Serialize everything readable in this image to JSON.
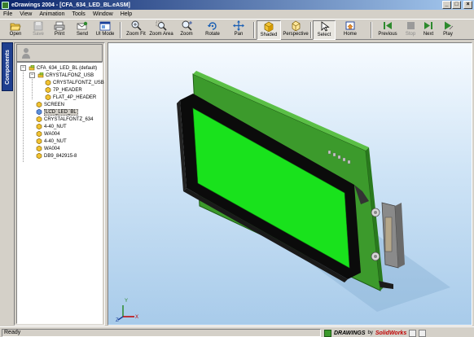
{
  "window": {
    "title": "eDrawings 2004 - [CFA_634_LED_BL.eASM]",
    "controls": {
      "minimize": "_",
      "maximize": "□",
      "close": "×"
    }
  },
  "menu": [
    "File",
    "View",
    "Animation",
    "Tools",
    "Window",
    "Help"
  ],
  "toolbar": {
    "buttons": [
      {
        "label": "Open",
        "icon": "open-folder-icon",
        "enabled": true
      },
      {
        "label": "Save",
        "icon": "save-disk-icon",
        "enabled": false
      },
      {
        "label": "Print",
        "icon": "printer-icon",
        "enabled": true
      },
      {
        "label": "Send",
        "icon": "send-mail-icon",
        "enabled": true
      },
      {
        "label": "UI Mode",
        "icon": "ui-mode-icon",
        "enabled": true
      },
      {
        "label": "Zoom Fit",
        "icon": "zoom-fit-icon",
        "enabled": true
      },
      {
        "label": "Zoom Area",
        "icon": "zoom-area-icon",
        "enabled": true
      },
      {
        "label": "Zoom",
        "icon": "zoom-icon",
        "enabled": true
      },
      {
        "label": "Rotate",
        "icon": "rotate-icon",
        "enabled": true
      },
      {
        "label": "Pan",
        "icon": "pan-icon",
        "enabled": true
      },
      {
        "label": "Shaded",
        "icon": "shaded-cube-icon",
        "enabled": true,
        "pressed": true
      },
      {
        "label": "Perspective",
        "icon": "perspective-cube-icon",
        "enabled": true
      },
      {
        "label": "Select",
        "icon": "select-arrow-icon",
        "enabled": true,
        "pressed": true
      },
      {
        "label": "Home",
        "icon": "home-icon",
        "enabled": true
      },
      {
        "label": "Previous",
        "icon": "previous-icon",
        "enabled": true
      },
      {
        "label": "Stop",
        "icon": "stop-icon",
        "enabled": false
      },
      {
        "label": "Next",
        "icon": "next-icon",
        "enabled": true
      },
      {
        "label": "Play",
        "icon": "play-icon",
        "enabled": true
      }
    ]
  },
  "side_tab": "Components",
  "tree": {
    "root": "CFA_634_LED_BL (default)",
    "items": [
      {
        "label": "CRYSTALFONZ_USB",
        "level": 1,
        "type": "assembly",
        "expanded": true
      },
      {
        "label": "CRYSTALFONTZ_USB",
        "level": 2,
        "type": "part"
      },
      {
        "label": "7P_HEADER",
        "level": 2,
        "type": "part"
      },
      {
        "label": "FLAT_4P_HEADER",
        "level": 2,
        "type": "part"
      },
      {
        "label": "SCREEN",
        "level": 1,
        "type": "part"
      },
      {
        "label": "LCD_LED_BL",
        "level": 1,
        "type": "part-blue",
        "selected": true
      },
      {
        "label": "CRYSTALFONTZ_634",
        "level": 1,
        "type": "part"
      },
      {
        "label": "4-40_NUT",
        "level": 1,
        "type": "part"
      },
      {
        "label": "WA004",
        "level": 1,
        "type": "part"
      },
      {
        "label": "4-40_NUT",
        "level": 1,
        "type": "part"
      },
      {
        "label": "WA004",
        "level": 1,
        "type": "part"
      },
      {
        "label": "DB9_842915-8",
        "level": 1,
        "type": "part"
      }
    ]
  },
  "triad": {
    "x": "X",
    "y": "Y",
    "z": "Z"
  },
  "status": {
    "text": "Ready",
    "brand_drawings": "DRAWINGS",
    "brand_by": "by",
    "brand_solidworks": "SolidWorks"
  },
  "colors": {
    "pcb_green": "#3c9a2c",
    "lcd_green": "#19e21c",
    "bezel_black": "#0b0b0b",
    "title_blue": "#0a246a"
  }
}
